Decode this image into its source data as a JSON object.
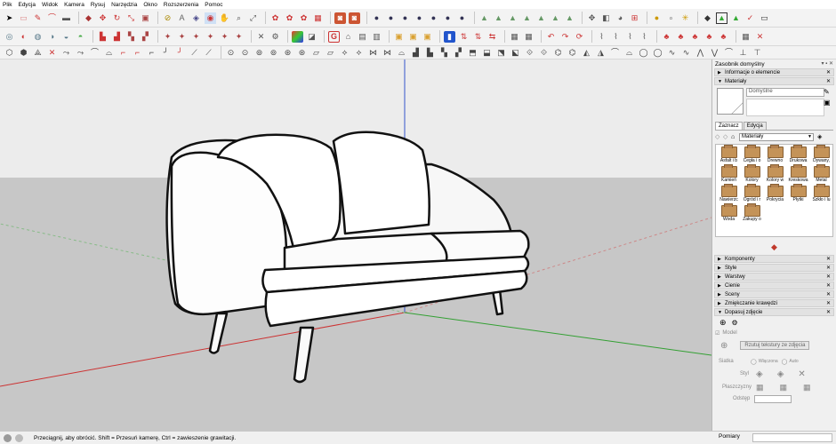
{
  "menu": [
    "Plik",
    "Edycja",
    "Widok",
    "Kamera",
    "Rysuj",
    "Narzędzia",
    "Okno",
    "Rozszerzenia",
    "Pomoc"
  ],
  "status": {
    "hint": "Przeciągnij, aby obrócić. Shift = Przesuń kamerę, Ctrl = zawieszenie grawitacji.",
    "measurements_label": "Pomiary"
  },
  "tray": {
    "title": "Zasobnik domyślny",
    "panels_top": [
      "Informacje o elemencie",
      "Materiały"
    ],
    "material_name": "Domyślne",
    "tabs": [
      "Zaznacz",
      "Edycja"
    ],
    "library": "Materiały",
    "materials": [
      "Asfalt i b",
      "Cegła i o",
      "Drewno",
      "Drukowa",
      "Dywany,",
      "Kamień",
      "Kolory",
      "Kolory w",
      "Kreskowa",
      "Metal",
      "Nawierzc",
      "Ogród i r",
      "Pokrycia",
      "Płytki",
      "Szkło i lu",
      "Woda",
      "Zakupy o"
    ],
    "panels_bottom": [
      "Komponenty",
      "Style",
      "Warstwy",
      "Cienie",
      "Sceny",
      "Zmiękczanie krawędzi",
      "Dopasuj zdjęcie"
    ],
    "photo": {
      "model_label": "Model",
      "project_button": "Rzutuj tekstury ze zdjęcia",
      "grid_label": "Siatka",
      "grid_on": "Włączona",
      "grid_auto": "Auto",
      "style_label": "Styl",
      "planes_label": "Płaszczyzny",
      "spacing_label": "Odstęp"
    }
  },
  "colors": {
    "sky": "#ededed",
    "ground": "#c8c8c8",
    "axis_red": "#cc3333",
    "axis_green": "#33a033",
    "axis_blue": "#3355cc"
  }
}
